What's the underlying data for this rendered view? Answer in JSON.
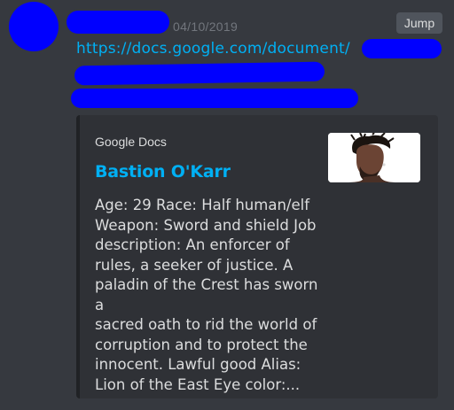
{
  "message": {
    "timestamp": "04/10/2019",
    "jump_label": "Jump",
    "link_visible": "https://docs.google.com/document/"
  },
  "embed": {
    "provider": "Google Docs",
    "title": "Bastion O'Karr",
    "description": "Age: 29 Race: Half human/elf\nWeapon: Sword and shield Job\ndescription: An enforcer of\nrules, a seeker of justice. A\npaladin of the Crest has sworn a\nsacred oath to rid the world of\ncorruption and to protect the\ninnocent. Lawful good Alias:\nLion of the East Eye color:..."
  },
  "colors": {
    "background": "#36393f",
    "embed_background": "#2f3136",
    "link": "#00b0f4",
    "redaction": "#0000ff"
  }
}
